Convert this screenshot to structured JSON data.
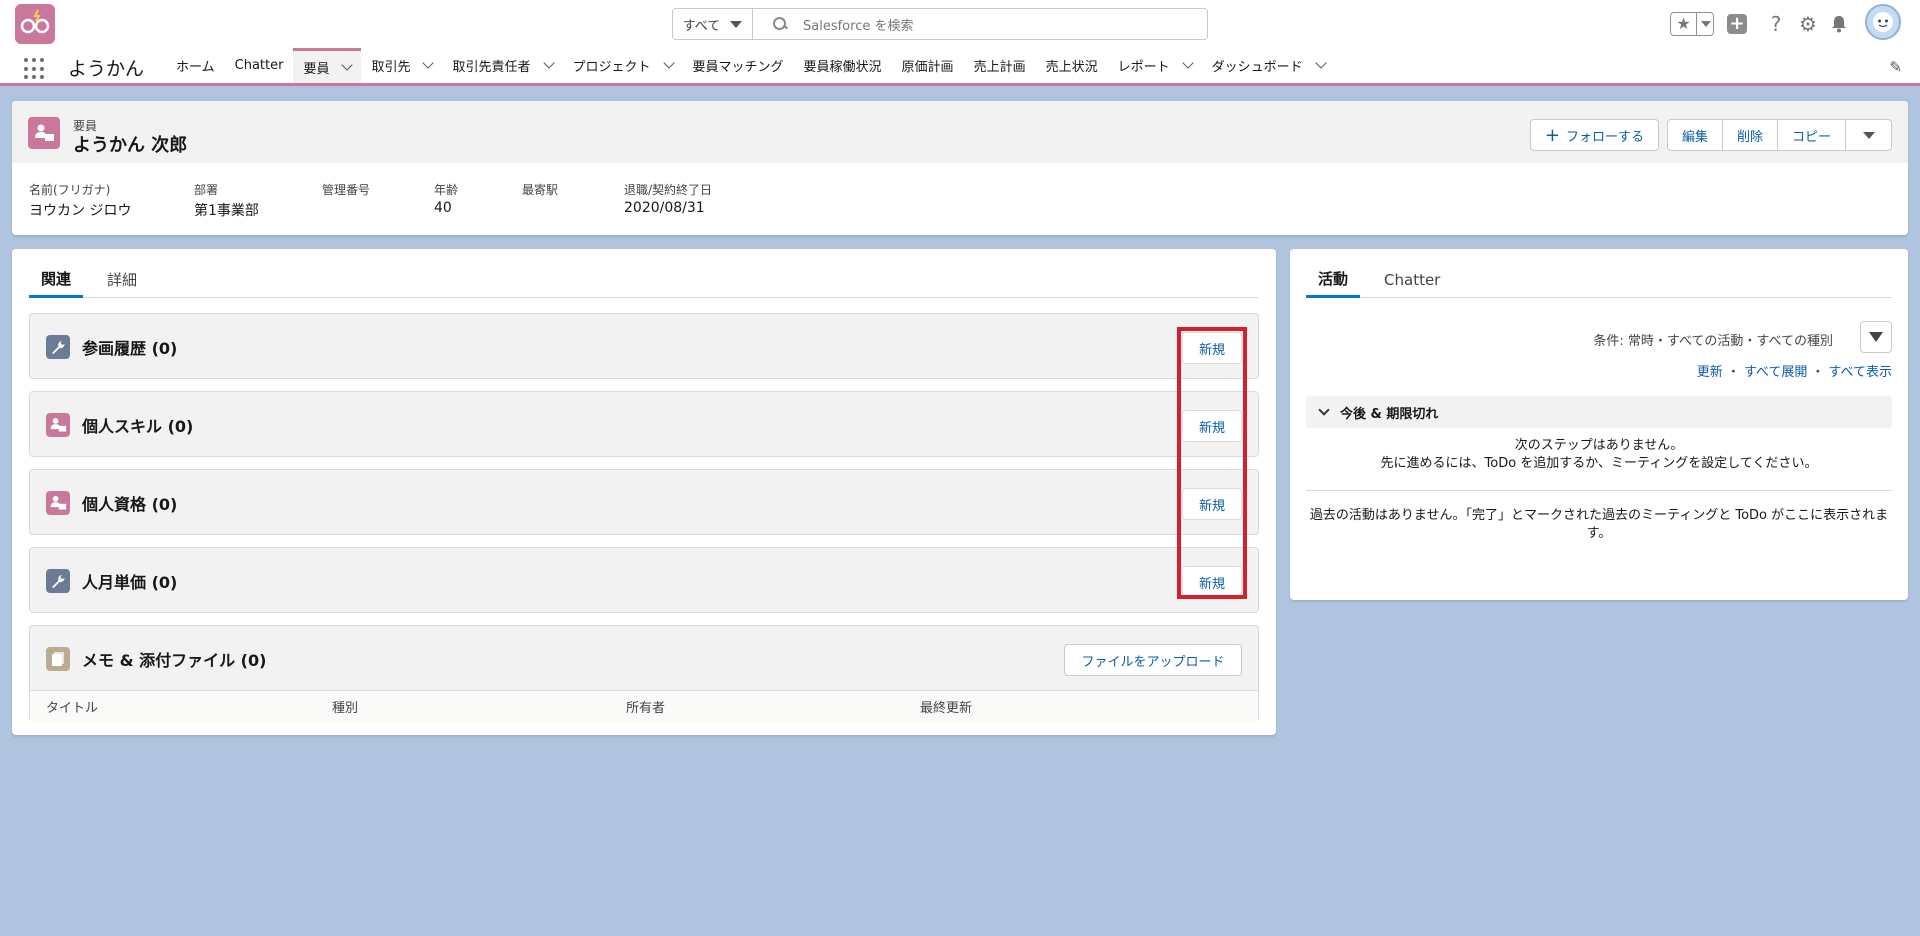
{
  "header": {
    "search_scope": "すべて",
    "search_placeholder": "Salesforce を検索"
  },
  "nav": {
    "app_name": "ようかん",
    "items": [
      {
        "label": "ホーム",
        "dropdown": false
      },
      {
        "label": "Chatter",
        "dropdown": false
      },
      {
        "label": "要員",
        "dropdown": true,
        "active": true
      },
      {
        "label": "取引先",
        "dropdown": true
      },
      {
        "label": "取引先責任者",
        "dropdown": true
      },
      {
        "label": "プロジェクト",
        "dropdown": true
      },
      {
        "label": "要員マッチング",
        "dropdown": false
      },
      {
        "label": "要員稼働状況",
        "dropdown": false
      },
      {
        "label": "原価計画",
        "dropdown": false
      },
      {
        "label": "売上計画",
        "dropdown": false
      },
      {
        "label": "売上状況",
        "dropdown": false
      },
      {
        "label": "レポート",
        "dropdown": true
      },
      {
        "label": "ダッシュボード",
        "dropdown": true
      }
    ]
  },
  "record": {
    "object_label": "要員",
    "title": "ようかん 次郎",
    "actions": {
      "follow": "フォローする",
      "edit": "編集",
      "delete": "削除",
      "copy": "コピー"
    },
    "fields": [
      {
        "label": "名前(フリガナ)",
        "value": "ヨウカン ジロウ"
      },
      {
        "label": "部署",
        "value": "第1事業部"
      },
      {
        "label": "管理番号",
        "value": ""
      },
      {
        "label": "年齢",
        "value": "40"
      },
      {
        "label": "最寄駅",
        "value": ""
      },
      {
        "label": "退職/契約終了日",
        "value": "2020/08/31"
      }
    ]
  },
  "main": {
    "tabs": [
      "関連",
      "詳細"
    ],
    "related_lists": [
      {
        "title": "参画履歴 (0)",
        "icon": "wrench-icon",
        "new_label": "新規"
      },
      {
        "title": "個人スキル (0)",
        "icon": "person-card-icon",
        "new_label": "新規"
      },
      {
        "title": "個人資格 (0)",
        "icon": "person-card-icon",
        "new_label": "新規"
      },
      {
        "title": "人月単価 (0)",
        "icon": "wrench-icon",
        "new_label": "新規"
      }
    ],
    "files": {
      "title": "メモ & 添付ファイル (0)",
      "upload_label": "ファイルをアップロード",
      "columns": [
        "タイトル",
        "種別",
        "所有者",
        "最終更新"
      ]
    }
  },
  "activity": {
    "tabs": [
      "活動",
      "Chatter"
    ],
    "filter_text": "条件: 常時・すべての活動・すべての種別",
    "links": [
      "更新",
      "すべて展開",
      "すべて表示"
    ],
    "upcoming_label": "今後 & 期限切れ",
    "no_steps_line1": "次のステップはありません。",
    "no_steps_line2": "先に進めるには、ToDo を追加するか、ミーティングを設定してください。",
    "past_text": "過去の活動はありません。「完了」とマークされた過去のミーティングと ToDo がここに表示されます。"
  },
  "colors": {
    "brand": "#c9789b",
    "link": "#0b5cab",
    "highlight": "#d4202b",
    "background": "#b0c4df"
  }
}
